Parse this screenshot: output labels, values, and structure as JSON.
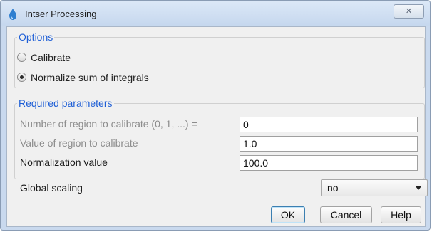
{
  "window": {
    "title": "Intser Processing",
    "icon": "app-icon",
    "close_glyph": "✕",
    "close_icon": "close-icon"
  },
  "options": {
    "legend": "Options",
    "radios": [
      {
        "label": "Calibrate",
        "checked": false
      },
      {
        "label": "Normalize sum of integrals",
        "checked": true
      }
    ]
  },
  "params": {
    "legend": "Required parameters",
    "rows": [
      {
        "label": "Number of region to calibrate (0, 1, ...) =",
        "value": "0",
        "enabled": false
      },
      {
        "label": "Value of region to calibrate",
        "value": "1.0",
        "enabled": false
      },
      {
        "label": "Normalization value",
        "value": "100.0",
        "enabled": true
      }
    ]
  },
  "scaling": {
    "label": "Global scaling",
    "selected": "no"
  },
  "buttons": {
    "ok": "OK",
    "cancel": "Cancel",
    "help": "Help"
  },
  "colors": {
    "legend": "#1f5fd6",
    "disabled_text": "#8c8c8c",
    "window_frame": "#c9d9ee"
  }
}
